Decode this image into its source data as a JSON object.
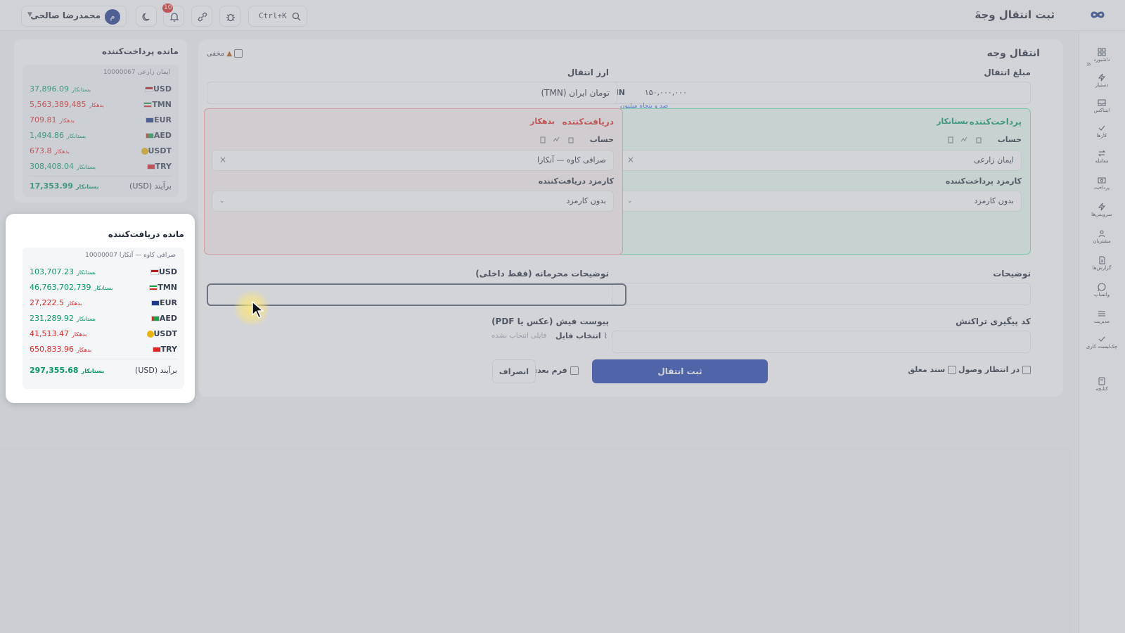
{
  "header": {
    "title": "ثبت انتقال وجه",
    "help": "؟",
    "user_name": "محمدرضا صالحی",
    "avatar_initial": "م",
    "notifications_count": "10",
    "search_shortcut": "Ctrl+K"
  },
  "sidebar": {
    "collapse": "»",
    "items": [
      {
        "label": "داشبورد",
        "icon": "dashboard-icon"
      },
      {
        "label": "دستیار",
        "icon": "bolt-icon"
      },
      {
        "label": "اینباکس",
        "icon": "inbox-icon"
      },
      {
        "label": "کارها",
        "icon": "check-icon"
      },
      {
        "label": "معامله",
        "icon": "exchange-icon"
      },
      {
        "label": "پرداخت",
        "icon": "payment-icon"
      },
      {
        "label": "سرویس‌ها",
        "icon": "bolt-icon"
      },
      {
        "label": "مشتریان",
        "icon": "users-icon"
      },
      {
        "label": "گزارش‌ها",
        "icon": "report-icon"
      },
      {
        "label": "واتساپ",
        "icon": "chat-icon"
      },
      {
        "label": "مدیریت",
        "icon": "sliders-icon"
      },
      {
        "label": "چک‌لیست کاری",
        "icon": "checklist-icon"
      },
      {
        "label": "کتابچه",
        "icon": "book-icon"
      }
    ]
  },
  "form": {
    "title": "انتقال وجه",
    "hidden_label": "مخفی",
    "amount_label": "مبلغ انتقال",
    "amount_currency": "TMN",
    "amount_value": "۱۵۰,۰۰۰,۰۰۰",
    "amount_words": "صد و پنجاه میلیون",
    "currency_label": "ارز انتقال",
    "currency_value": "تومان ایران (TMN)",
    "payer": {
      "title": "پرداخت‌کننده",
      "status": "بستانکار",
      "account_label": "حساب",
      "account_value": "ایمان زارعی",
      "fee_label": "کارمزد پرداخت‌کننده",
      "fee_value": "بدون کارمزد"
    },
    "payee": {
      "title": "دریافت‌کننده",
      "status": "بدهکار",
      "account_label": "حساب",
      "account_value": "صرافی کاوه — آنکارا",
      "fee_label": "کارمزد دریافت‌کننده",
      "fee_value": "بدون کارمزد"
    },
    "description_label": "توضیحات",
    "private_notes_label": "توضیحات محرمانه (فقط داخلی)",
    "tracking_label": "کد پیگیری تراکنش",
    "attachment_label": "پیوست فیش (عکس یا PDF)",
    "file_button": "انتخاب فایل",
    "file_none": "فایلی انتخاب نشده",
    "submit": "ثبت انتقال",
    "cancel": "انصراف",
    "next_form": "فرم بعدی",
    "pending_receipt": "در انتظار وصول",
    "suspended_doc": "سند معلق"
  },
  "payer_balance": {
    "title": "مانده پرداخت‌کننده",
    "account": "ایمان زارعی 10000067",
    "rows": [
      {
        "currency": "USD",
        "value": "37,896.09",
        "status": "بستانکار",
        "sign": "pos"
      },
      {
        "currency": "TMN",
        "value": "5,563,389,485",
        "status": "بدهکار",
        "sign": "neg"
      },
      {
        "currency": "EUR",
        "value": "709.81",
        "status": "بدهکار",
        "sign": "neg"
      },
      {
        "currency": "AED",
        "value": "1,494.86",
        "status": "بستانکار",
        "sign": "pos"
      },
      {
        "currency": "USDT",
        "value": "673.8",
        "status": "بدهکار",
        "sign": "neg"
      },
      {
        "currency": "TRY",
        "value": "308,408.04",
        "status": "بستانکار",
        "sign": "pos"
      }
    ],
    "total_label": "برآیند (USD)",
    "total_value": "17,353.99",
    "total_status": "بستانکار"
  },
  "payee_balance": {
    "title": "مانده دریافت‌کننده",
    "account": "صرافی کاوه — آنکارا 10000007",
    "rows": [
      {
        "currency": "USD",
        "value": "103,707.23",
        "status": "بستانکار",
        "sign": "pos"
      },
      {
        "currency": "TMN",
        "value": "46,763,702,739",
        "status": "بستانکار",
        "sign": "pos"
      },
      {
        "currency": "EUR",
        "value": "27,222.5",
        "status": "بدهکار",
        "sign": "neg"
      },
      {
        "currency": "AED",
        "value": "231,289.92",
        "status": "بستانکار",
        "sign": "pos"
      },
      {
        "currency": "USDT",
        "value": "41,513.47",
        "status": "بدهکار",
        "sign": "neg"
      },
      {
        "currency": "TRY",
        "value": "650,833.96",
        "status": "بدهکار",
        "sign": "neg"
      }
    ],
    "total_label": "برآیند (USD)",
    "total_value": "297,355.68",
    "total_status": "بستانکار"
  },
  "colors": {
    "accent": "#1e40af",
    "positive": "#059669",
    "negative": "#dc2626"
  }
}
